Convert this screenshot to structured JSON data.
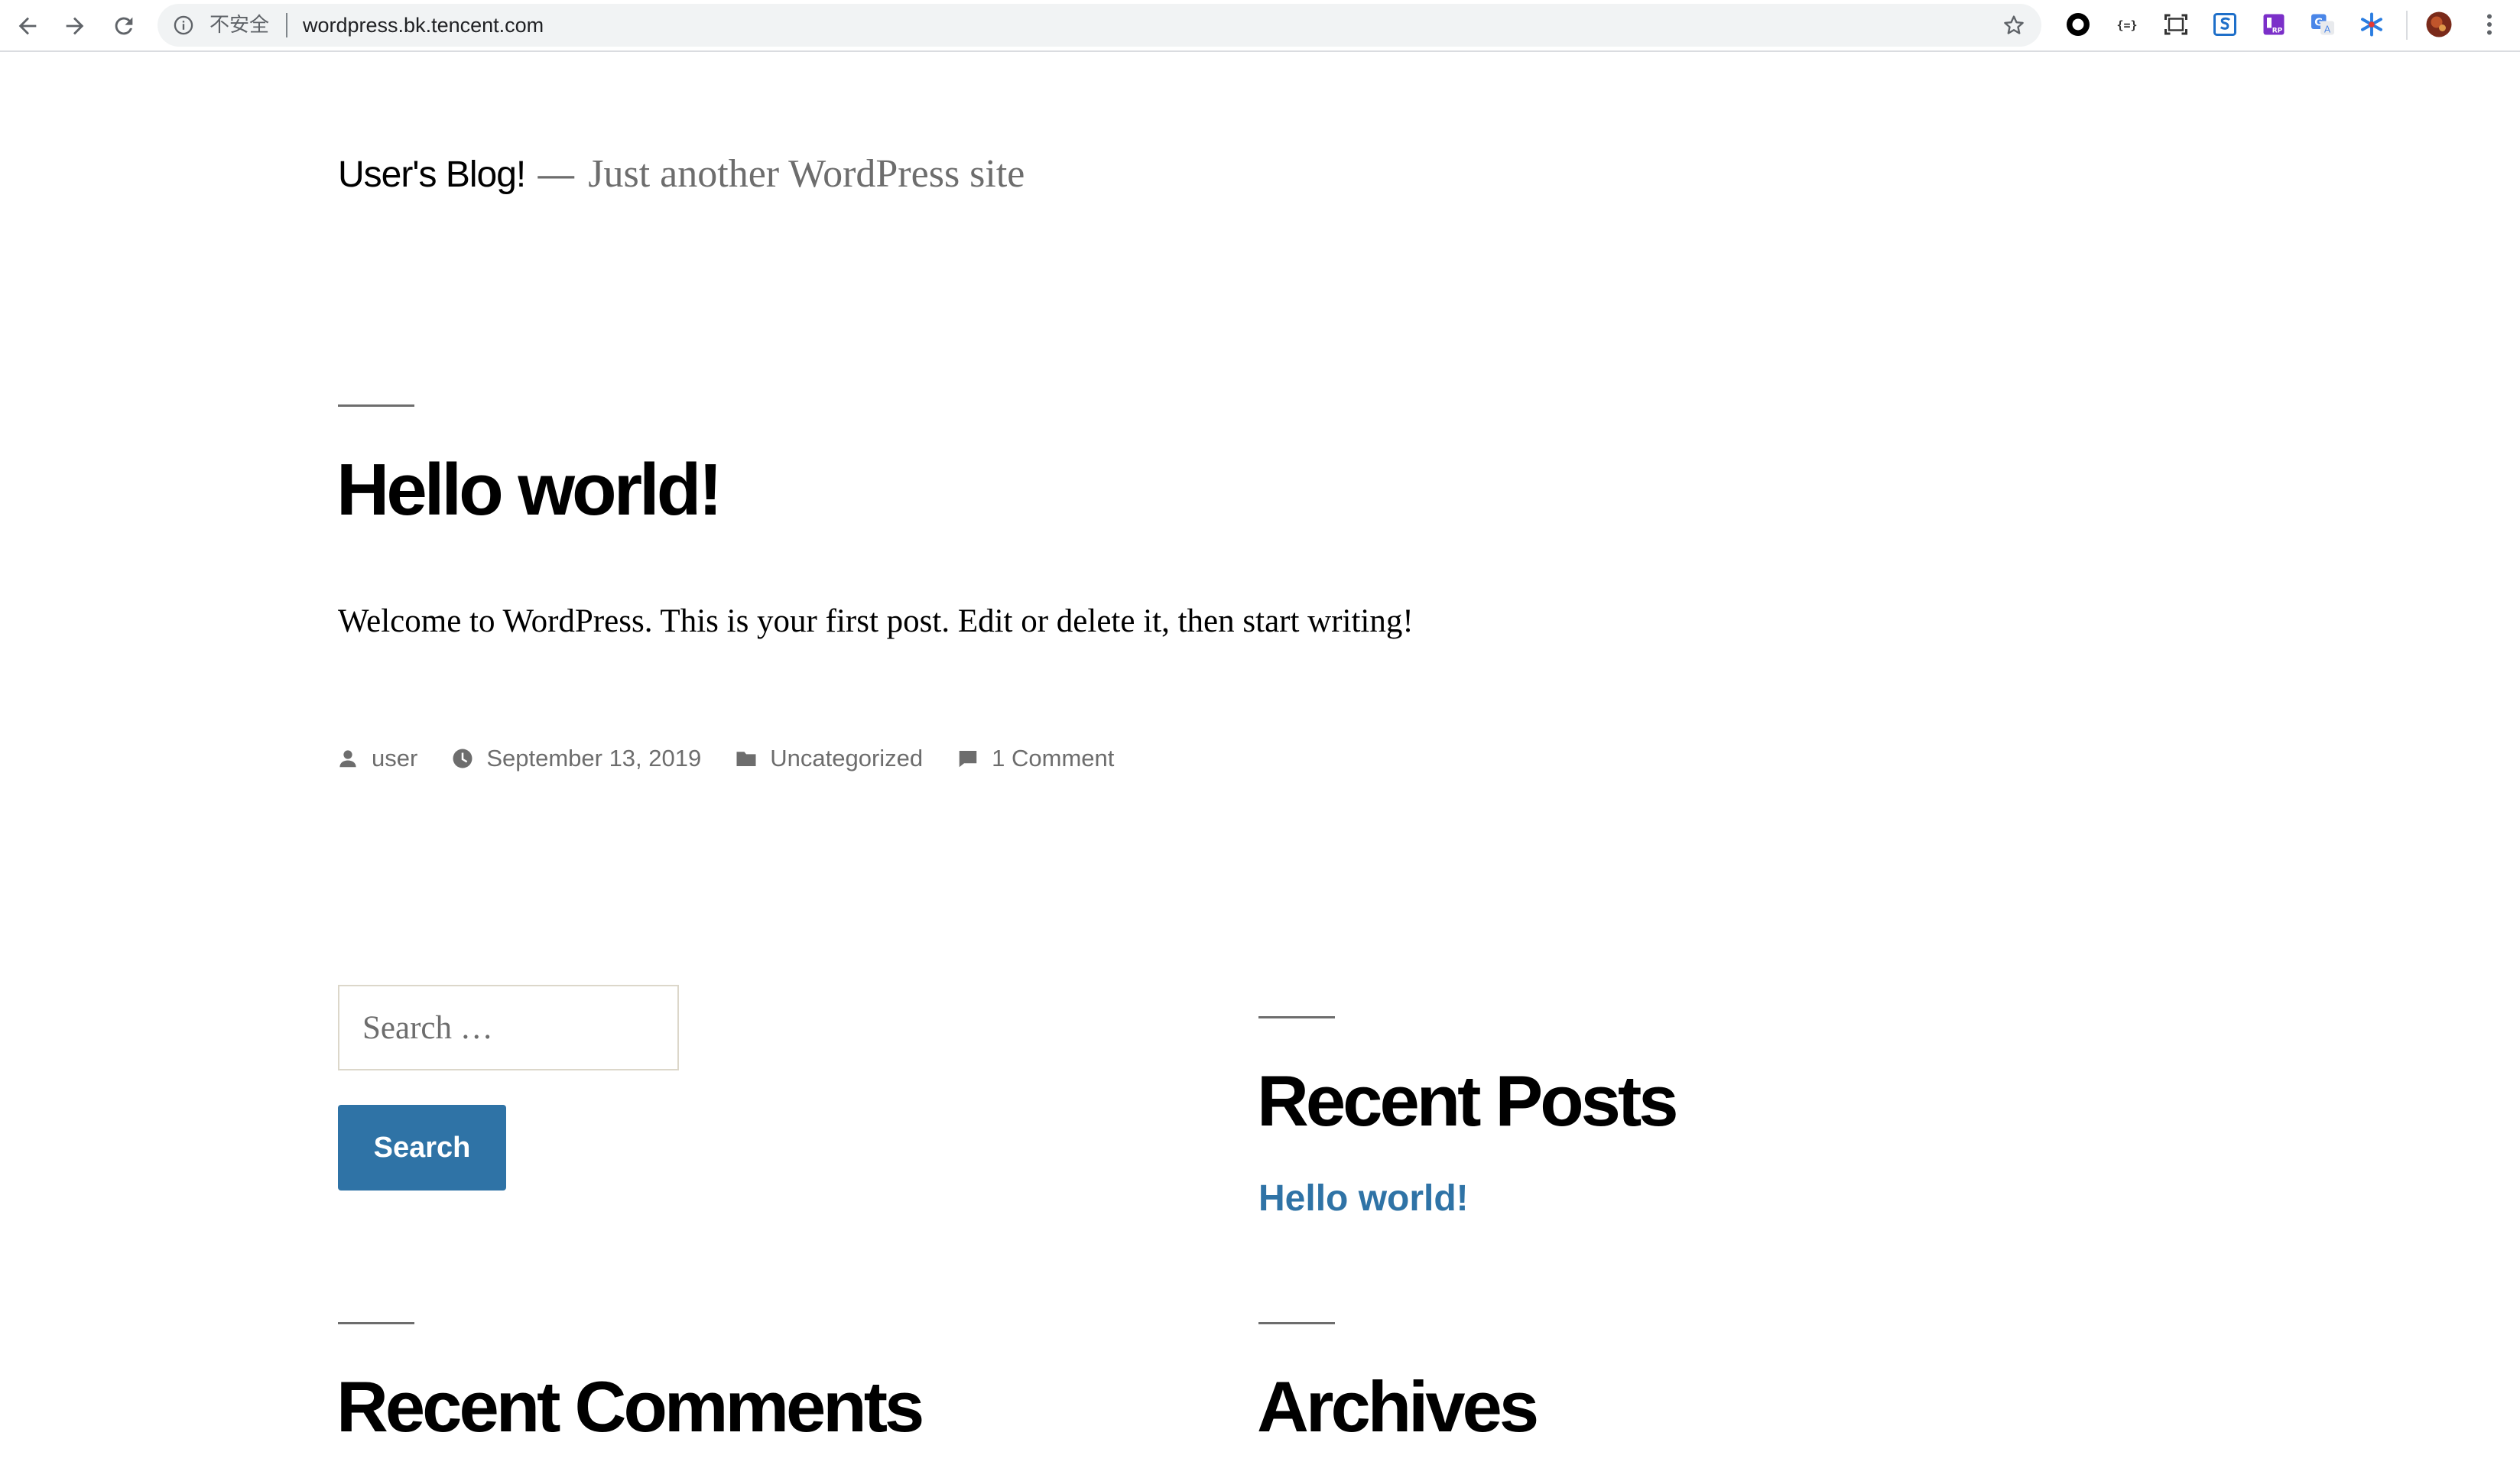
{
  "browser": {
    "security_label": "不安全",
    "url": "wordpress.bk.tencent.com",
    "icons": [
      "back-icon",
      "forward-icon",
      "reload-icon",
      "info-icon",
      "star-icon",
      "extension-icons",
      "avatar",
      "menu-icon"
    ]
  },
  "site": {
    "title": "User's Blog!",
    "separator": "—",
    "tagline": "Just another WordPress site"
  },
  "post": {
    "title": "Hello world!",
    "excerpt": "Welcome to WordPress. This is your first post. Edit or delete it, then start writing!",
    "meta": {
      "author": "user",
      "date": "September 13, 2019",
      "category": "Uncategorized",
      "comments": "1 Comment"
    }
  },
  "sidebar": {
    "search": {
      "placeholder": "Search …",
      "button_label": "Search"
    },
    "recent_posts": {
      "title": "Recent Posts",
      "items": [
        "Hello world!"
      ]
    },
    "recent_comments": {
      "title": "Recent Comments"
    },
    "archives": {
      "title": "Archives"
    }
  },
  "colors": {
    "link": "#2f73a6",
    "button": "#2f73a6",
    "meta_text": "#6d6d6d"
  }
}
